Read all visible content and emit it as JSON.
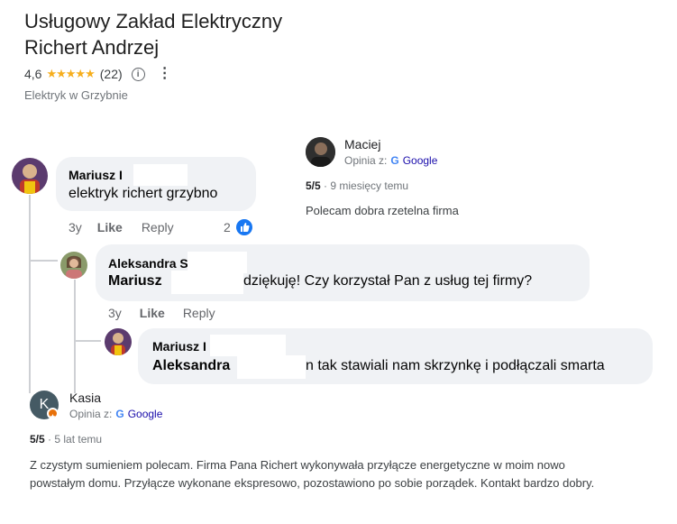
{
  "business": {
    "title_line1": "Usługowy Zakład Elektryczny",
    "title_line2": "Richert Andrzej",
    "rating": "4,6",
    "stars": "★★★★★",
    "review_count": "(22)",
    "info_glyph": "i",
    "more_glyph": "⋮",
    "category": "Elektryk w Grzybnie"
  },
  "google_review_1": {
    "author": "Maciej",
    "source_label": "Opinia z:",
    "source_name": "Google",
    "score": "5/5",
    "time": "· 9 miesięcy temu",
    "text": "Polecam dobra rzetelna firma"
  },
  "fb_thread": {
    "comment1": {
      "author": "Mariusz I",
      "text": "elektryk richert grzybno",
      "time": "3y",
      "like": "Like",
      "reply": "Reply",
      "reaction_count": "2"
    },
    "comment2": {
      "author": "Aleksandra S",
      "mention": "Mariusz",
      "text": "dziękuję! Czy korzystał Pan z usług tej firmy?",
      "time": "3y",
      "like": "Like",
      "reply": "Reply"
    },
    "comment3": {
      "author": "Mariusz I",
      "mention": "Aleksandra",
      "text": "n tak stawiali nam skrzynkę i podłączali smarta"
    }
  },
  "google_review_2": {
    "avatar_letter": "K",
    "author": "Kasia",
    "source_label": "Opinia z:",
    "source_name": "Google",
    "score": "5/5",
    "time": "· 5 lat temu",
    "text": "Z czystym sumieniem polecam. Firma Pana Richert wykonywała przyłącze energetyczne w moim nowo powstałym domu. Przyłącze wykonane ekspresowo, pozostawiono po sobie porządek. Kontakt bardzo dobry."
  },
  "colors": {
    "star": "#f6ae1d",
    "fb_like_blue": "#1877f2",
    "bubble": "#f0f2f5",
    "avatar_k": "#455a64"
  }
}
